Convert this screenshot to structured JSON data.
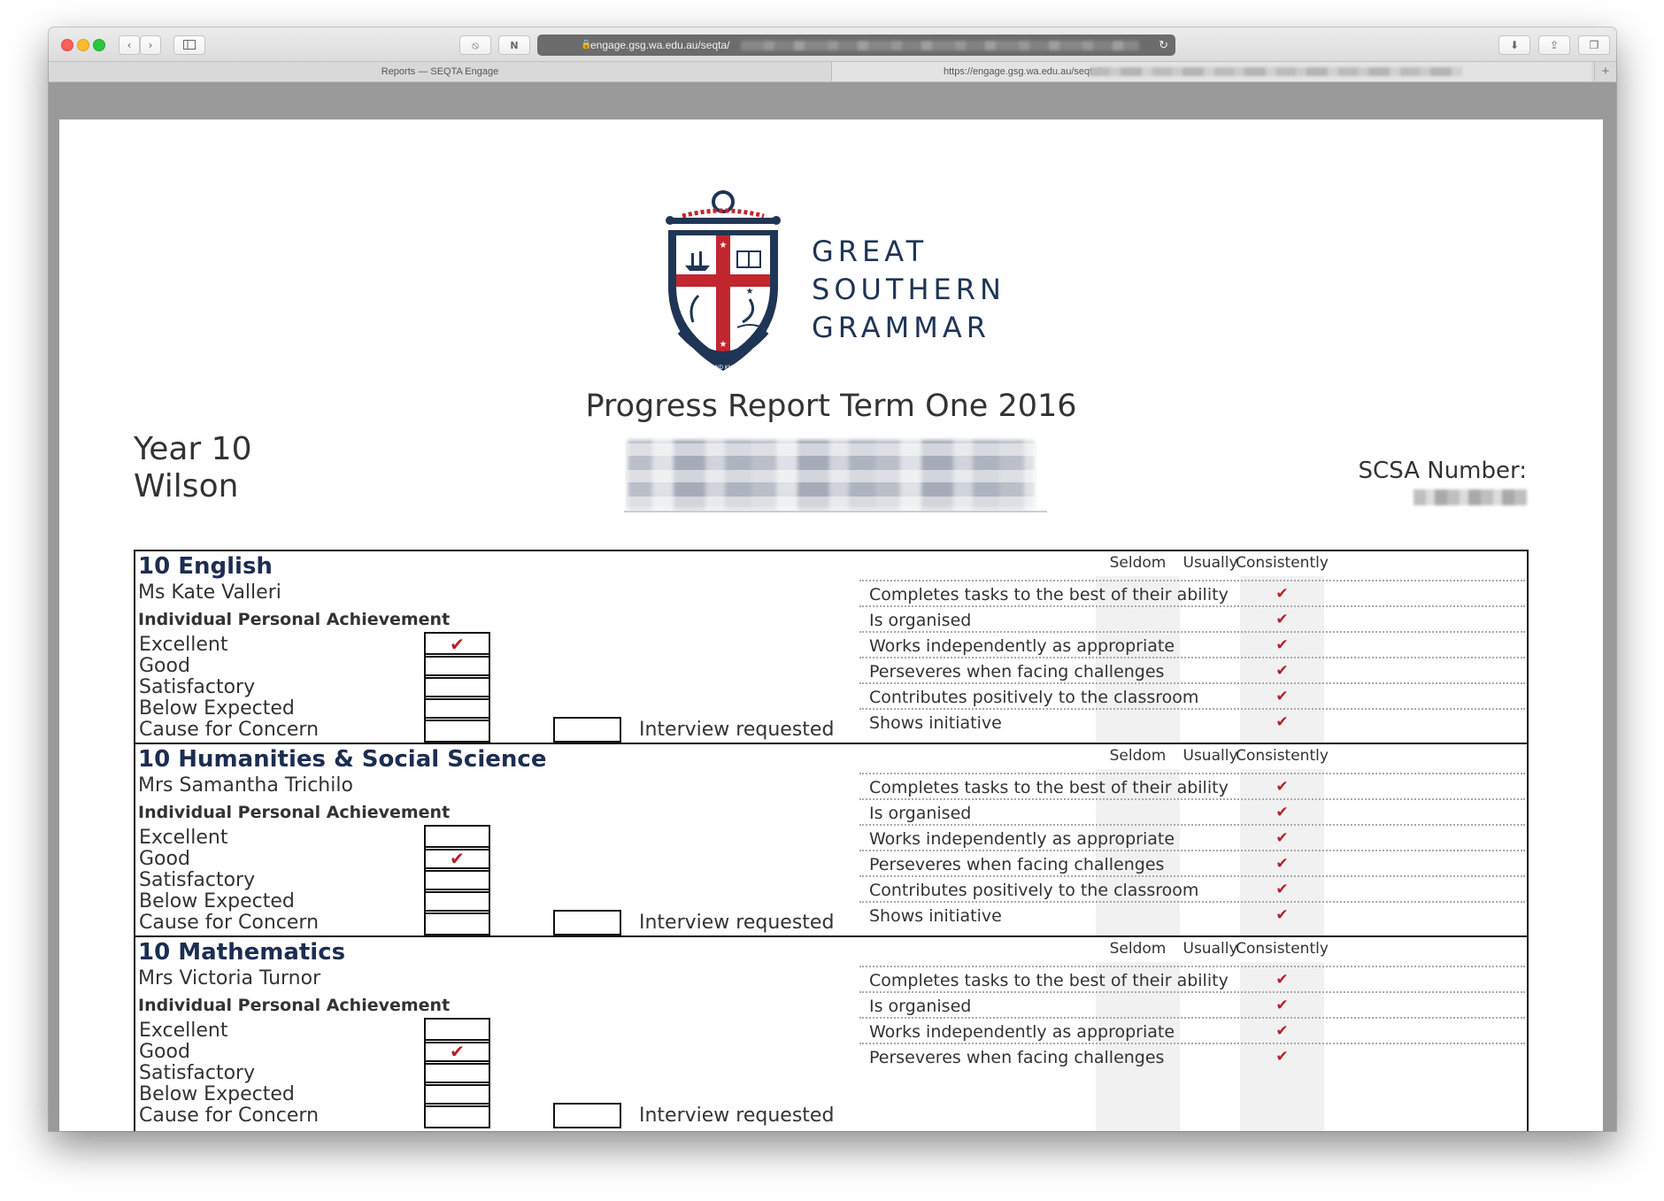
{
  "browser": {
    "url": "engage.gsg.wa.edu.au/seqta/",
    "tabs": [
      {
        "label": "Reports — SEQTA Engage"
      },
      {
        "label": "https://engage.gsg.wa.edu.au/seqta/"
      }
    ]
  },
  "school": {
    "line1": "GREAT",
    "line2": "SOUTHERN",
    "line3": "GRAMMAR",
    "crest_motto": "WISDOM AND KNOWLEDGE"
  },
  "report": {
    "title": "Progress Report Term One 2016",
    "year": "Year 10",
    "house": "Wilson",
    "scsa_label": "SCSA Number:"
  },
  "common": {
    "ipa_heading": "Individual Personal Achievement",
    "interview_label": "Interview requested",
    "freq_labels": [
      "Seldom",
      "Usually",
      "Consistently"
    ],
    "achievement_levels": [
      "Excellent",
      "Good",
      "Satisfactory",
      "Below Expected",
      "Cause for Concern"
    ],
    "behaviours": [
      "Completes tasks to the best of their ability",
      "Is organised",
      "Works independently as appropriate",
      "Perseveres when facing challenges",
      "Contributes positively to the classroom",
      "Shows initiative"
    ],
    "check": "✔"
  },
  "subjects": [
    {
      "name": "10 English",
      "teacher": "Ms Kate Valleri",
      "achievement": "Excellent",
      "behaviour_ratings": [
        "Consistently",
        "Consistently",
        "Consistently",
        "Consistently",
        "Consistently",
        "Consistently"
      ]
    },
    {
      "name": "10 Humanities & Social Science",
      "teacher": "Mrs Samantha Trichilo",
      "achievement": "Good",
      "behaviour_ratings": [
        "Consistently",
        "Consistently",
        "Consistently",
        "Consistently",
        "Consistently",
        "Consistently"
      ]
    },
    {
      "name": "10 Mathematics",
      "teacher": "Mrs Victoria Turnor",
      "achievement": "Good",
      "behaviour_ratings": [
        "Consistently",
        "Consistently",
        "Consistently",
        "Consistently"
      ]
    }
  ],
  "colors": {
    "navy": "#1c2d52",
    "check_red": "#b52025",
    "crest_red": "#c2262e"
  }
}
